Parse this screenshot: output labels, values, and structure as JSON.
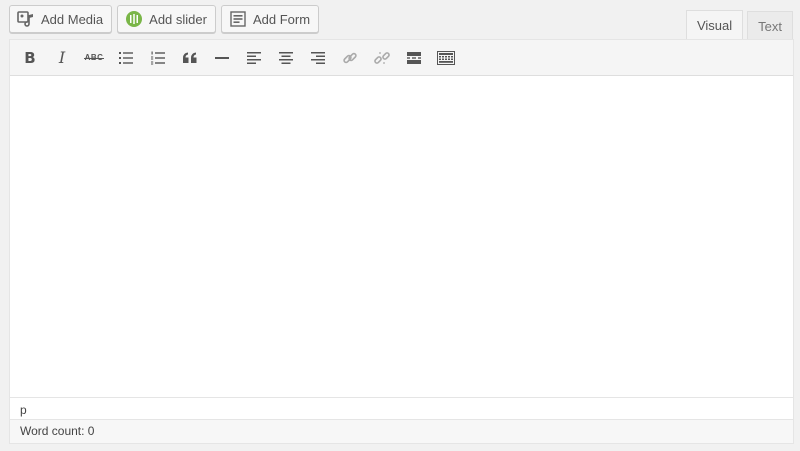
{
  "media_buttons": {
    "add_media": "Add Media",
    "add_slider": "Add slider",
    "add_form": "Add Form"
  },
  "tabs": [
    {
      "label": "Visual",
      "active": true
    },
    {
      "label": "Text",
      "active": false
    }
  ],
  "toolbar": {
    "bold": "B",
    "italic": "I",
    "strikethrough": "ABC"
  },
  "path_bar": {
    "element": "p"
  },
  "status_bar": {
    "word_count": "Word count: 0"
  },
  "colors": {
    "slider_icon": "#7ab648",
    "icon": "#555555",
    "disabled_icon": "#bbbbbb"
  }
}
